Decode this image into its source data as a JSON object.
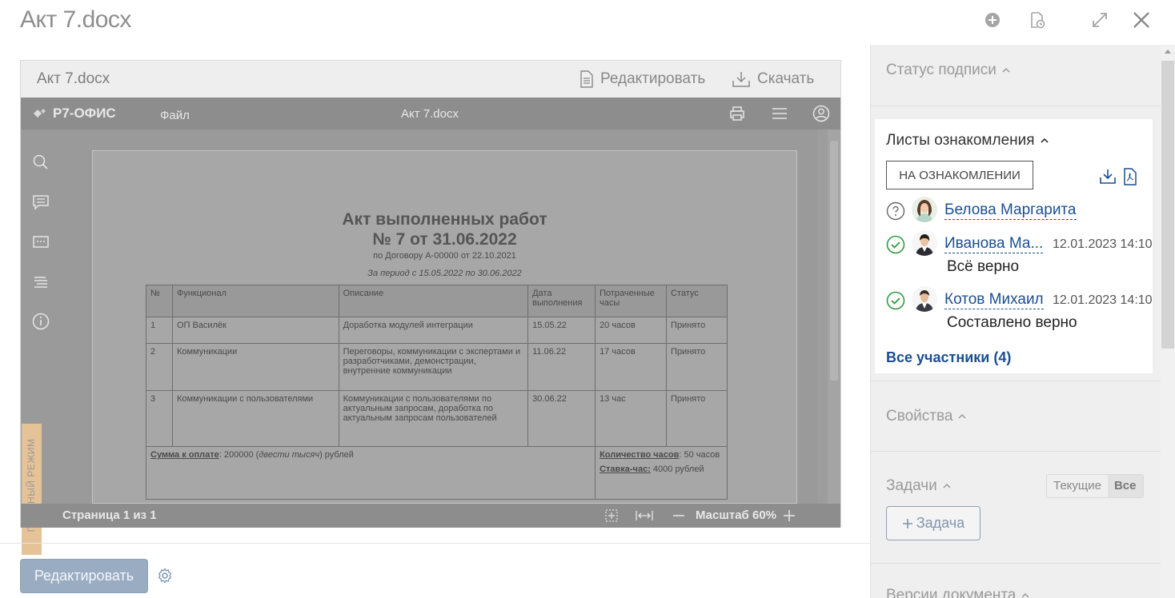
{
  "window": {
    "title": "Акт 7.docx"
  },
  "header_icons": [
    "plus-circle-icon",
    "document-clock-icon",
    "expand-icon",
    "close-icon"
  ],
  "preview": {
    "file_name": "Акт 7.docx",
    "edit_label": "Редактировать",
    "download_label": "Скачать"
  },
  "editor": {
    "logo": "Р7-ОФИС",
    "file_menu": "Файл",
    "doc_title": "Акт 7.docx",
    "trial_mode": "ПРОБНЫЙ РЕЖИМ",
    "page_status": "Страница 1 из 1",
    "zoom_label": "Масштаб 60%"
  },
  "document": {
    "title_line1": "Акт выполненных работ",
    "title_line2": "№ 7 от 31.06.2022",
    "contract": "по Договору А-00000 от 22.10.2021",
    "period": "За период с 15.05.2022 по 30.06.2022",
    "columns": [
      "№",
      "Функционал",
      "Описание",
      "Дата выполнения",
      "Потраченные часы",
      "Статус"
    ],
    "rows": [
      [
        "1",
        "ОП Василёк",
        "Доработка модулей интеграции",
        "15.05.22",
        "20 часов",
        "Принято"
      ],
      [
        "2",
        "Коммуникации",
        "Переговоры, коммуникации с экспертами и разработчиками, демонстрации, внутренние коммуникации",
        "11.06.22",
        "17 часов",
        "Принято"
      ],
      [
        "3",
        "Коммуникации с пользователями",
        "Коммуникации с пользователями по актуальным запросам, доработка по актуальным запросам пользователей",
        "30.06.22",
        "13 час",
        "Принято"
      ]
    ],
    "sum_label": "Сумма к оплате",
    "sum_value": ": 200000 (",
    "sum_words": "двести тысяч",
    "sum_tail": ") рублей",
    "hours_label": "Количество часов",
    "hours_value": ": 50 часов",
    "rate_label": "Ставка-час:",
    "rate_value": " 4000 рублей"
  },
  "bottom": {
    "edit_button": "Редактировать"
  },
  "right_panel": {
    "signature_status": "Статус подписи",
    "acquaintance_title": "Листы ознакомления",
    "acquaintance_button": "НА ОЗНАКОМЛЕНИИ",
    "participants": [
      {
        "name": "Белова Маргарита",
        "status": "pending",
        "date": "",
        "comment": ""
      },
      {
        "name": "Иванова Ма...",
        "status": "done",
        "date": "12.01.2023 14:10",
        "comment": "Всё верно"
      },
      {
        "name": "Котов Михаил",
        "status": "done",
        "date": "12.01.2023 14:10",
        "comment": "Составлено верно"
      }
    ],
    "all_participants": "Все участники (4)",
    "properties": "Свойства",
    "tasks": "Задачи",
    "tab_current": "Текущие",
    "tab_all": "Все",
    "add_task": "Задача",
    "versions": "Версии документа"
  },
  "colors": {
    "accent": "#1b4f8f",
    "ok": "#2e9b3a",
    "button": "#9aacc2",
    "trial": "#e6c397"
  }
}
